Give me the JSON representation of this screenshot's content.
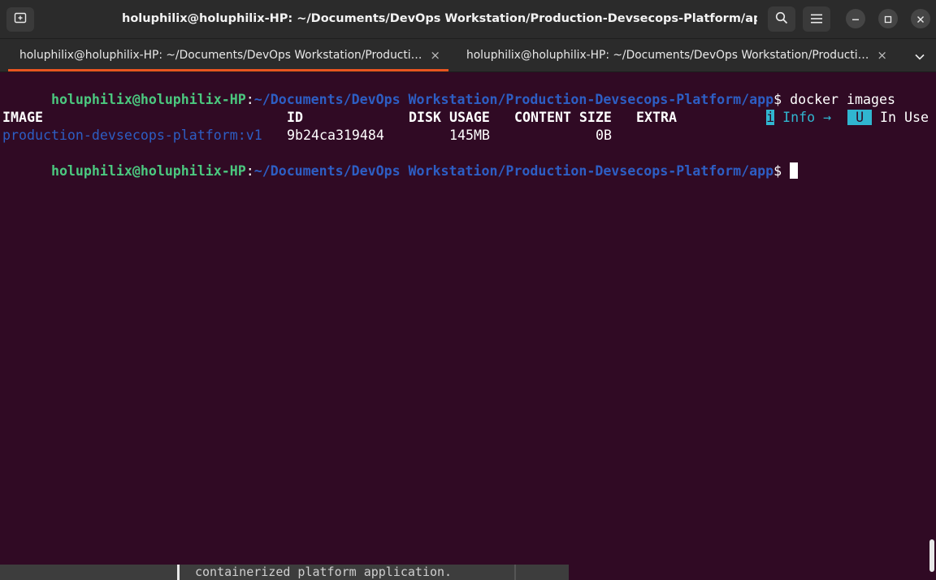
{
  "window": {
    "title": "holuphilix@holuphilix-HP: ~/Documents/DevOps Workstation/Production-Devsecops-Platform/app"
  },
  "tabs": [
    {
      "label": "holuphilix@holuphilix-HP: ~/Documents/DevOps Workstation/Productio…",
      "close": "×",
      "active": true
    },
    {
      "label": "holuphilix@holuphilix-HP: ~/Documents/DevOps Workstation/Productio…",
      "close": "×",
      "active": false
    }
  ],
  "terminal": {
    "prompt": {
      "user_host": "holuphilix@holuphilix-HP",
      "colon": ":",
      "path": "~/Documents/DevOps Workstation/Production-Devsecops-Platform/app",
      "symbol": "$ "
    },
    "command": "docker images",
    "legend": {
      "info_key": "i",
      "info_label": " Info →",
      "use_key": " U ",
      "use_label": " In Use"
    },
    "table": {
      "headers": [
        "IMAGE",
        "ID",
        "DISK USAGE",
        "CONTENT SIZE",
        "EXTRA"
      ],
      "rows": [
        {
          "image": "production-devsecops-platform:v1",
          "id": "9b24ca319484",
          "disk_usage": "145MB",
          "content_size": "0B",
          "extra": ""
        }
      ]
    }
  },
  "background_window_text": "containerized platform application.",
  "colors": {
    "terminal_bg": "#300a24",
    "prompt_user": "#4bc87f",
    "prompt_path": "#2d5ec4",
    "accent": "#e95420",
    "legend_cyan": "#30b6d0"
  },
  "icons": {
    "new_tab": "new-tab-icon",
    "search": "search-icon",
    "menu": "hamburger-menu-icon",
    "minimize": "minimize-icon",
    "maximize": "maximize-icon",
    "close": "close-icon",
    "tab_list": "chevron-down-icon"
  }
}
